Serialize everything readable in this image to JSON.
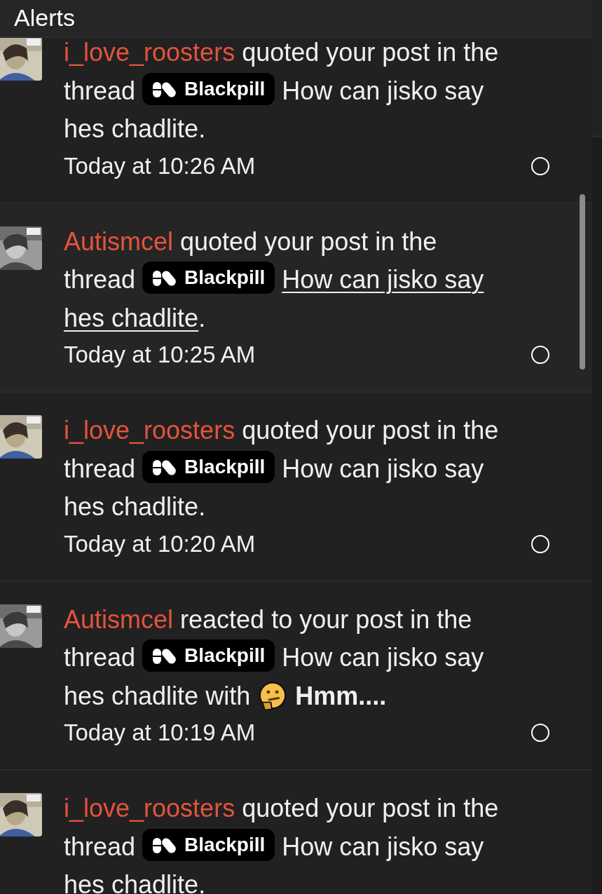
{
  "header": {
    "title": "Alerts"
  },
  "alerts": [
    {
      "user": "i_love_roosters",
      "action": "quoted your post in the thread",
      "prefix": "Blackpill",
      "thread_lines": [
        "How can jisko say",
        "hes chadlite"
      ],
      "suffix": ".",
      "time": "Today at 10:26 AM",
      "hovered": false
    },
    {
      "user": "Autismcel",
      "action": "quoted your post in the thread",
      "prefix": "Blackpill",
      "thread_lines": [
        "How can jisko say",
        "hes chadlite"
      ],
      "suffix": ".",
      "time": "Today at 10:25 AM",
      "hovered": true
    },
    {
      "user": "i_love_roosters",
      "action": "quoted your post in the thread",
      "prefix": "Blackpill",
      "thread_lines": [
        "How can jisko say",
        "hes chadlite"
      ],
      "suffix": ".",
      "time": "Today at 10:20 AM",
      "hovered": false
    },
    {
      "user": "Autismcel",
      "action": "reacted to your post in the thread",
      "prefix": "Blackpill",
      "thread_lines": [
        "How can jisko say",
        "hes chadlite"
      ],
      "reaction": {
        "connector": "with",
        "label": "Hmm...."
      },
      "time": "Today at 10:19 AM",
      "hovered": false
    },
    {
      "user": "i_love_roosters",
      "action": "quoted your post in the thread",
      "prefix": "Blackpill",
      "thread_lines": [
        "How can jisko say",
        "hes chadlite"
      ],
      "suffix": ".",
      "hovered": false
    }
  ]
}
